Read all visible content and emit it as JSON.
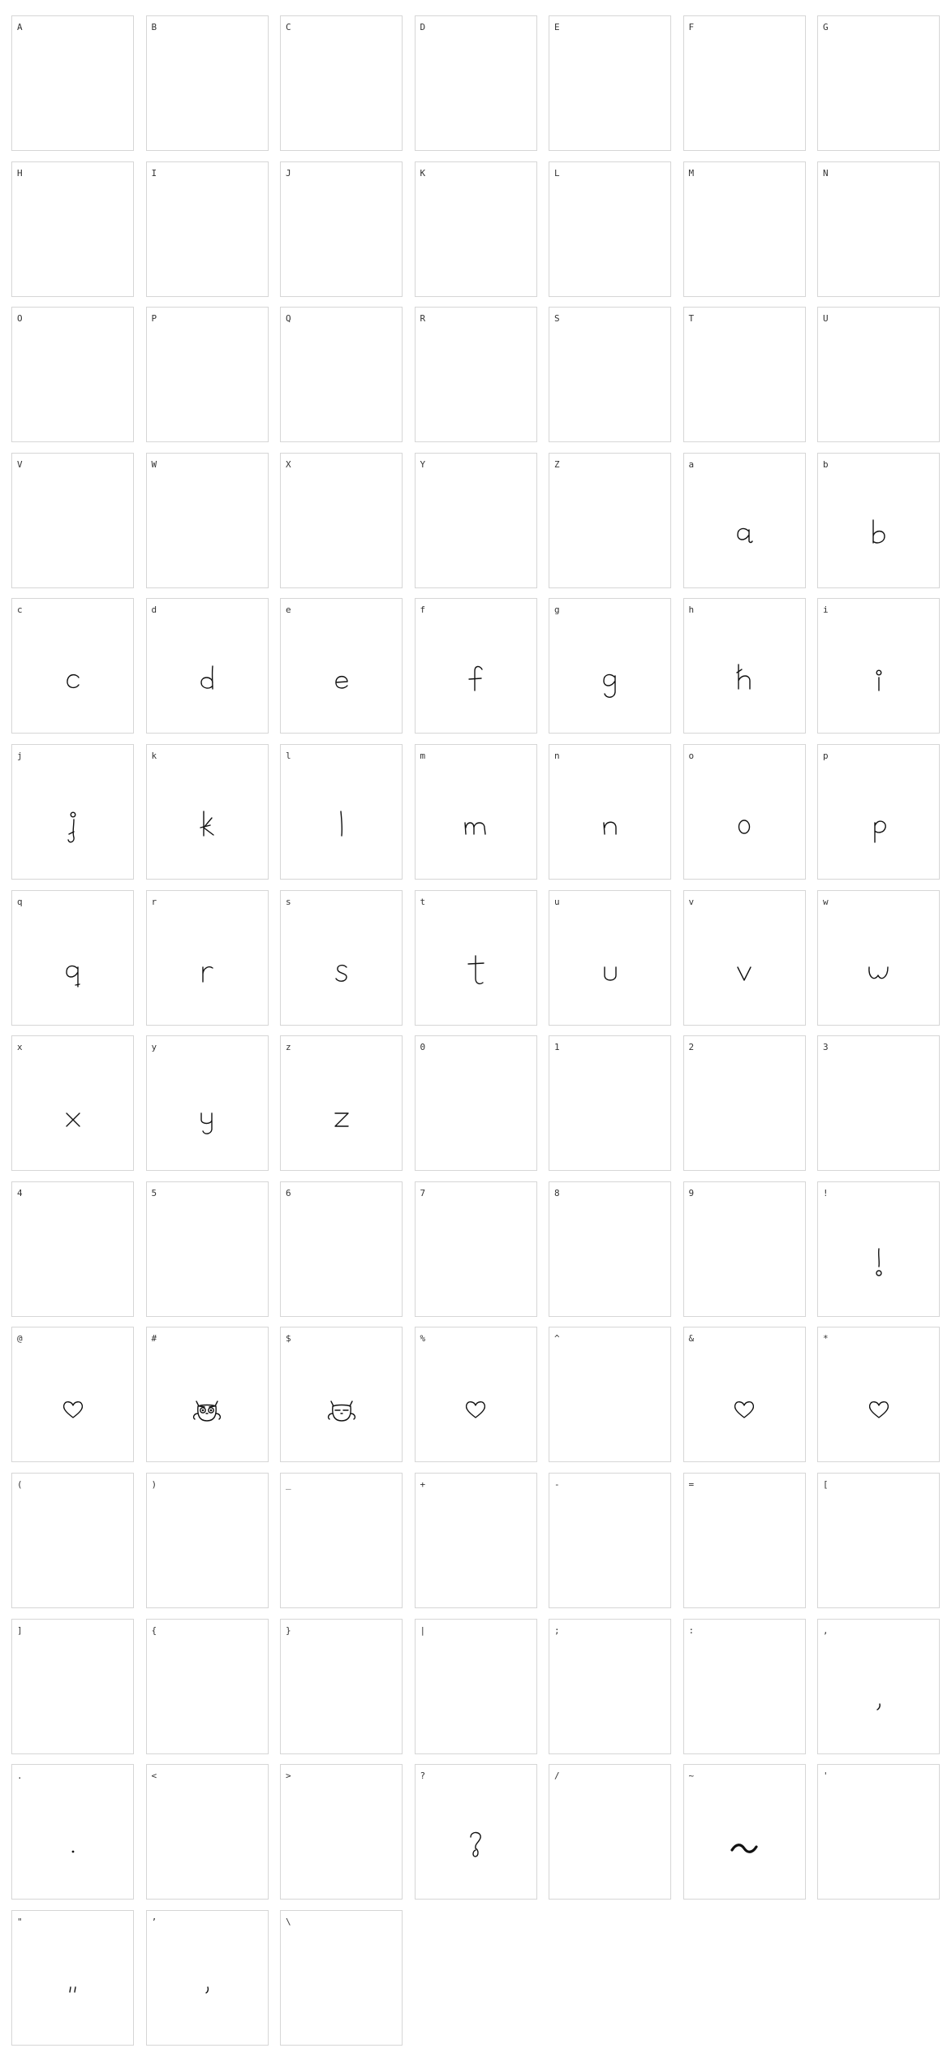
{
  "glyphs": [
    {
      "label": "A",
      "glyph": "none"
    },
    {
      "label": "B",
      "glyph": "none"
    },
    {
      "label": "C",
      "glyph": "none"
    },
    {
      "label": "D",
      "glyph": "none"
    },
    {
      "label": "E",
      "glyph": "none"
    },
    {
      "label": "F",
      "glyph": "none"
    },
    {
      "label": "G",
      "glyph": "none"
    },
    {
      "label": "H",
      "glyph": "none"
    },
    {
      "label": "I",
      "glyph": "none"
    },
    {
      "label": "J",
      "glyph": "none"
    },
    {
      "label": "K",
      "glyph": "none"
    },
    {
      "label": "L",
      "glyph": "none"
    },
    {
      "label": "M",
      "glyph": "none"
    },
    {
      "label": "N",
      "glyph": "none"
    },
    {
      "label": "O",
      "glyph": "none"
    },
    {
      "label": "P",
      "glyph": "none"
    },
    {
      "label": "Q",
      "glyph": "none"
    },
    {
      "label": "R",
      "glyph": "none"
    },
    {
      "label": "S",
      "glyph": "none"
    },
    {
      "label": "T",
      "glyph": "none"
    },
    {
      "label": "U",
      "glyph": "none"
    },
    {
      "label": "V",
      "glyph": "none"
    },
    {
      "label": "W",
      "glyph": "none"
    },
    {
      "label": "X",
      "glyph": "none"
    },
    {
      "label": "Y",
      "glyph": "none"
    },
    {
      "label": "Z",
      "glyph": "none"
    },
    {
      "label": "a",
      "glyph": "letter-a"
    },
    {
      "label": "b",
      "glyph": "letter-b"
    },
    {
      "label": "c",
      "glyph": "letter-c"
    },
    {
      "label": "d",
      "glyph": "letter-d"
    },
    {
      "label": "e",
      "glyph": "letter-e"
    },
    {
      "label": "f",
      "glyph": "letter-f"
    },
    {
      "label": "g",
      "glyph": "letter-g"
    },
    {
      "label": "h",
      "glyph": "letter-h"
    },
    {
      "label": "i",
      "glyph": "letter-i"
    },
    {
      "label": "j",
      "glyph": "letter-j"
    },
    {
      "label": "k",
      "glyph": "letter-k"
    },
    {
      "label": "l",
      "glyph": "letter-l"
    },
    {
      "label": "m",
      "glyph": "letter-m"
    },
    {
      "label": "n",
      "glyph": "letter-n"
    },
    {
      "label": "o",
      "glyph": "letter-o"
    },
    {
      "label": "p",
      "glyph": "letter-p"
    },
    {
      "label": "q",
      "glyph": "letter-q"
    },
    {
      "label": "r",
      "glyph": "letter-r"
    },
    {
      "label": "s",
      "glyph": "letter-s"
    },
    {
      "label": "t",
      "glyph": "letter-t"
    },
    {
      "label": "u",
      "glyph": "letter-u"
    },
    {
      "label": "v",
      "glyph": "letter-v"
    },
    {
      "label": "w",
      "glyph": "letter-w"
    },
    {
      "label": "x",
      "glyph": "letter-x"
    },
    {
      "label": "y",
      "glyph": "letter-y"
    },
    {
      "label": "z",
      "glyph": "letter-z"
    },
    {
      "label": "0",
      "glyph": "none"
    },
    {
      "label": "1",
      "glyph": "none"
    },
    {
      "label": "2",
      "glyph": "none"
    },
    {
      "label": "3",
      "glyph": "none"
    },
    {
      "label": "4",
      "glyph": "none"
    },
    {
      "label": "5",
      "glyph": "none"
    },
    {
      "label": "6",
      "glyph": "none"
    },
    {
      "label": "7",
      "glyph": "none"
    },
    {
      "label": "8",
      "glyph": "none"
    },
    {
      "label": "9",
      "glyph": "none"
    },
    {
      "label": "!",
      "glyph": "exclamation"
    },
    {
      "label": "@",
      "glyph": "heart"
    },
    {
      "label": "#",
      "glyph": "owl-open"
    },
    {
      "label": "$",
      "glyph": "owl-closed"
    },
    {
      "label": "%",
      "glyph": "heart"
    },
    {
      "label": "^",
      "glyph": "none"
    },
    {
      "label": "&",
      "glyph": "heart"
    },
    {
      "label": "*",
      "glyph": "heart"
    },
    {
      "label": "(",
      "glyph": "none"
    },
    {
      "label": ")",
      "glyph": "none"
    },
    {
      "label": "_",
      "glyph": "none"
    },
    {
      "label": "+",
      "glyph": "none"
    },
    {
      "label": "-",
      "glyph": "none"
    },
    {
      "label": "=",
      "glyph": "none"
    },
    {
      "label": "[",
      "glyph": "none"
    },
    {
      "label": "]",
      "glyph": "none"
    },
    {
      "label": "{",
      "glyph": "none"
    },
    {
      "label": "}",
      "glyph": "none"
    },
    {
      "label": "|",
      "glyph": "none"
    },
    {
      "label": ";",
      "glyph": "none"
    },
    {
      "label": ":",
      "glyph": "none"
    },
    {
      "label": ",",
      "glyph": "comma"
    },
    {
      "label": ".",
      "glyph": "period"
    },
    {
      "label": "<",
      "glyph": "none"
    },
    {
      "label": ">",
      "glyph": "none"
    },
    {
      "label": "?",
      "glyph": "question"
    },
    {
      "label": "/",
      "glyph": "none"
    },
    {
      "label": "~",
      "glyph": "tilde"
    },
    {
      "label": "'",
      "glyph": "none"
    },
    {
      "label": "\"",
      "glyph": "double-quote"
    },
    {
      "label": "’",
      "glyph": "apostrophe"
    },
    {
      "label": "\\",
      "glyph": "none"
    }
  ]
}
